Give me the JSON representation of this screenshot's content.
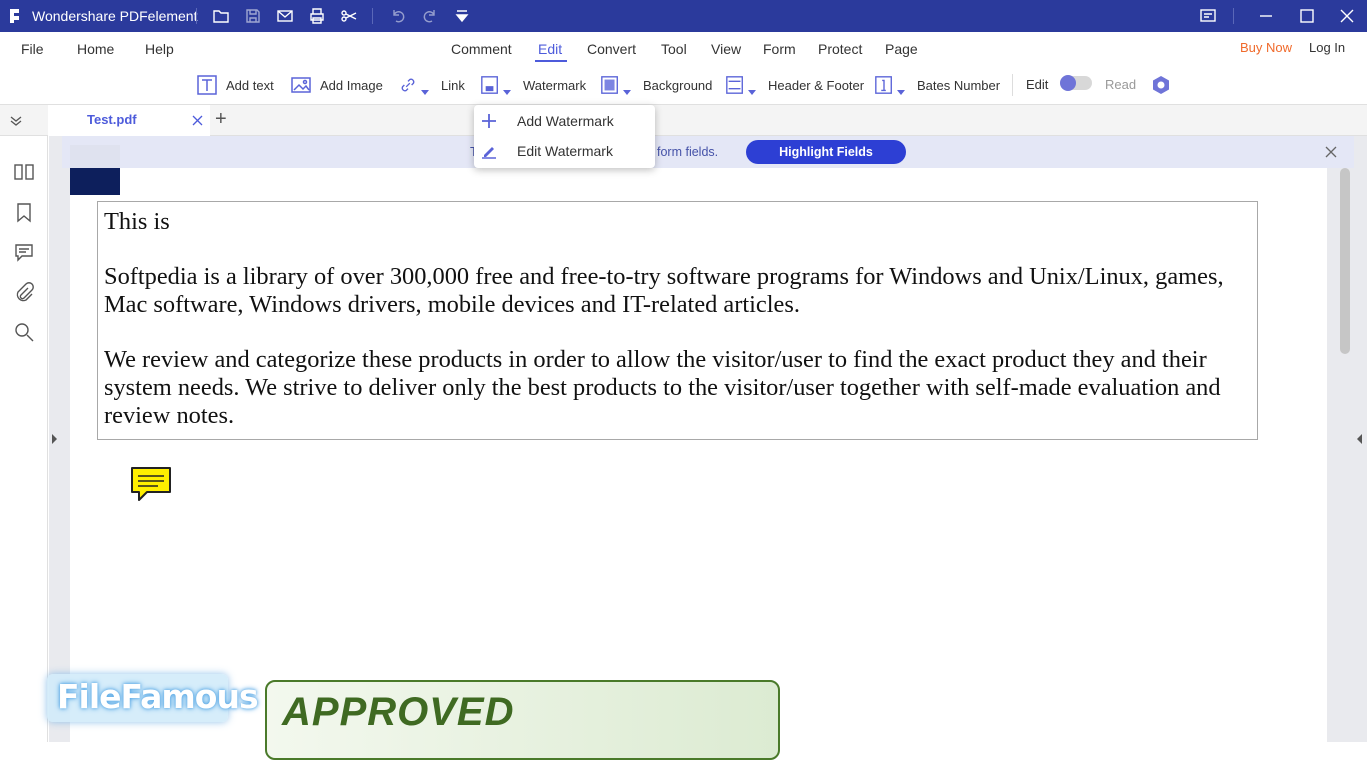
{
  "app": {
    "title": "Wondershare PDFelement"
  },
  "window_controls": {
    "feedback": "feedback-icon",
    "minimize": "minimize-icon",
    "maximize": "maximize-icon",
    "close": "close-icon"
  },
  "menu": {
    "left": [
      "File",
      "Home",
      "Help"
    ],
    "center": [
      "Comment",
      "Edit",
      "Convert",
      "Tool",
      "View",
      "Form",
      "Protect",
      "Page"
    ],
    "active": "Edit",
    "buy_now": "Buy Now",
    "login": "Log In"
  },
  "toolbar": {
    "add_text": "Add text",
    "add_image": "Add Image",
    "link": "Link",
    "watermark": "Watermark",
    "background": "Background",
    "header_footer": "Header & Footer",
    "bates_number": "Bates Number",
    "edit": "Edit",
    "read": "Read"
  },
  "tabs": {
    "items": [
      {
        "label": "Test.pdf"
      }
    ],
    "add": "+"
  },
  "formbar": {
    "message_tail": "form fields.",
    "highlight_button": "Highlight Fields",
    "message_head": "T"
  },
  "dropdown": {
    "items": [
      {
        "label": "Add Watermark",
        "icon": "plus-icon"
      },
      {
        "label": "Edit Watermark",
        "icon": "pencil-icon"
      }
    ]
  },
  "document": {
    "paragraphs": [
      "This is",
      "Softpedia is a library of over 300,000 free and free-to-try software programs for Windows and Unix/Linux, games, Mac software, Windows drivers, mobile devices and IT-related articles.",
      "We review and categorize these products in order to allow the visitor/user to find the exact product they and their system needs. We strive to deliver only the best products to the visitor/user together with self-made evaluation and review notes."
    ],
    "stamp_text": "APPROVED"
  },
  "watermark_logo": "FileFamous",
  "colors": {
    "titlebar": "#2b3a9c",
    "accent": "#4d5bdb",
    "buy_now": "#f06a2b",
    "highlight_button": "#2d3fd4",
    "stamp": "#3f6a22"
  }
}
